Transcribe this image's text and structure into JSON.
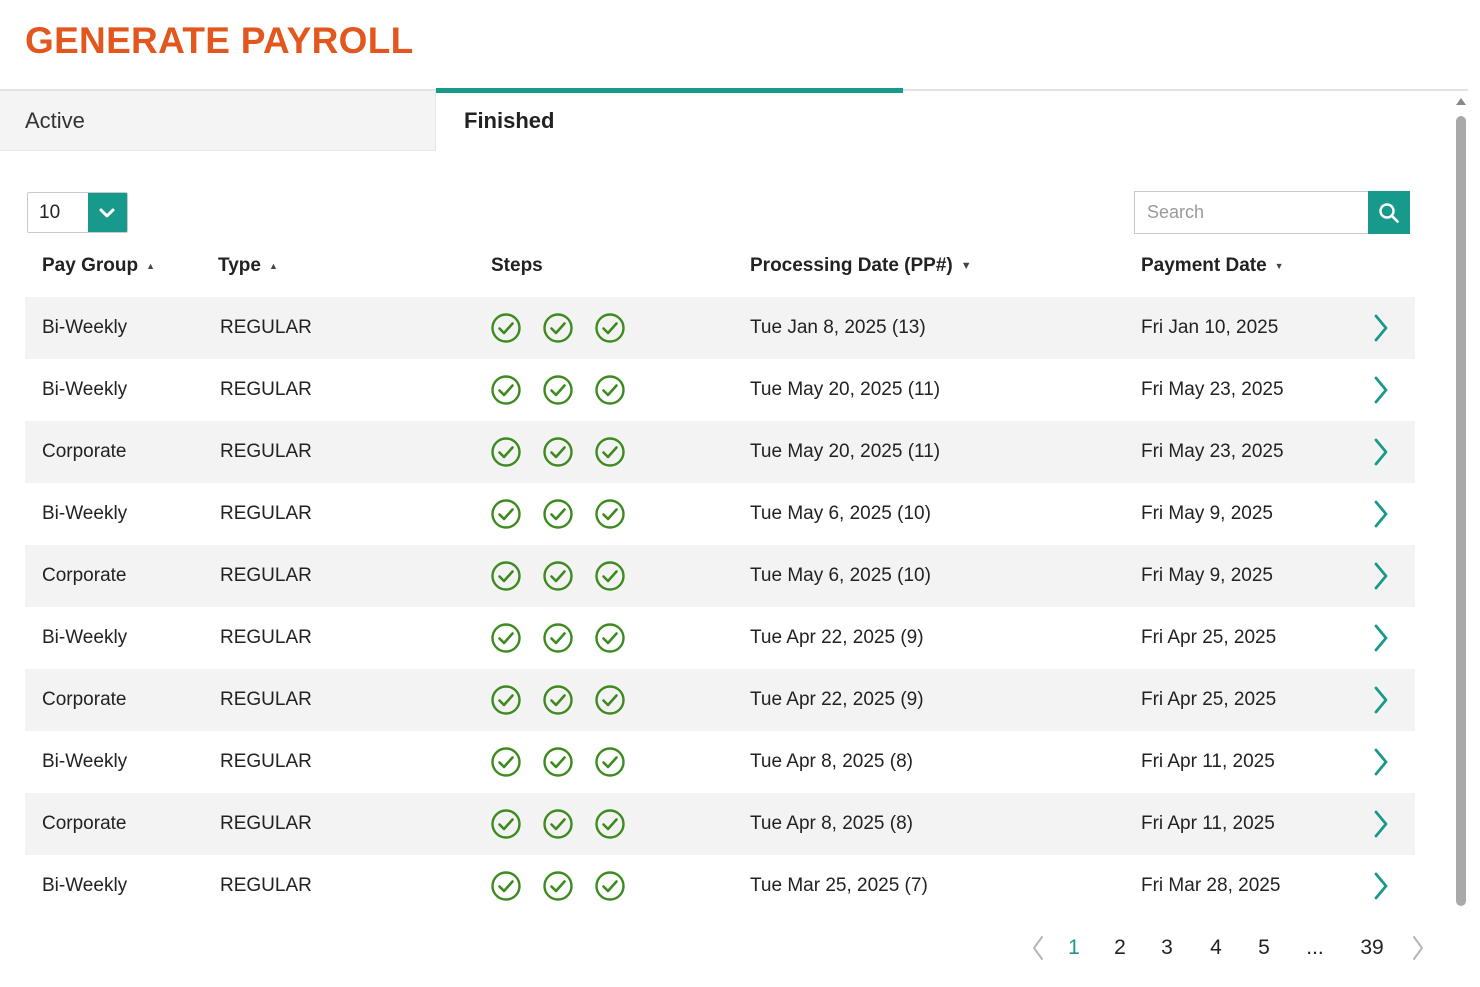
{
  "title": "GENERATE PAYROLL",
  "tabs": [
    {
      "label": "Active",
      "selected": false
    },
    {
      "label": "Finished",
      "selected": true
    }
  ],
  "accent_color": "#17998c",
  "title_color": "#e2571e",
  "step_check_color": "#3d8a1f",
  "page_size": {
    "value": "10",
    "icon": "chevron-down-icon"
  },
  "search": {
    "placeholder": "Search",
    "value": "",
    "icon": "search-icon"
  },
  "columns": [
    {
      "label": "Pay Group",
      "sort": "asc"
    },
    {
      "label": "Type",
      "sort": "asc"
    },
    {
      "label": "Steps",
      "sort": "none"
    },
    {
      "label": "Processing Date (PP#)",
      "sort": "desc"
    },
    {
      "label": "Payment Date",
      "sort": "desc"
    }
  ],
  "rows": [
    {
      "pay_group": "Bi-Weekly",
      "type": "REGULAR",
      "steps": [
        "done",
        "done",
        "done"
      ],
      "processing_date": "Tue Jan 8, 2025 (13)",
      "payment_date": "Fri Jan 10, 2025"
    },
    {
      "pay_group": "Bi-Weekly",
      "type": "REGULAR",
      "steps": [
        "done",
        "done",
        "done"
      ],
      "processing_date": "Tue May 20, 2025 (11)",
      "payment_date": "Fri May 23, 2025"
    },
    {
      "pay_group": "Corporate",
      "type": "REGULAR",
      "steps": [
        "done",
        "done",
        "done"
      ],
      "processing_date": "Tue May 20, 2025 (11)",
      "payment_date": "Fri May 23, 2025"
    },
    {
      "pay_group": "Bi-Weekly",
      "type": "REGULAR",
      "steps": [
        "done",
        "done",
        "done"
      ],
      "processing_date": "Tue May 6, 2025 (10)",
      "payment_date": "Fri May 9, 2025"
    },
    {
      "pay_group": "Corporate",
      "type": "REGULAR",
      "steps": [
        "done",
        "done",
        "done"
      ],
      "processing_date": "Tue May 6, 2025 (10)",
      "payment_date": "Fri May 9, 2025"
    },
    {
      "pay_group": "Bi-Weekly",
      "type": "REGULAR",
      "steps": [
        "done",
        "done",
        "done"
      ],
      "processing_date": "Tue Apr 22, 2025 (9)",
      "payment_date": "Fri Apr 25, 2025"
    },
    {
      "pay_group": "Corporate",
      "type": "REGULAR",
      "steps": [
        "done",
        "done",
        "done"
      ],
      "processing_date": "Tue Apr 22, 2025 (9)",
      "payment_date": "Fri Apr 25, 2025"
    },
    {
      "pay_group": "Bi-Weekly",
      "type": "REGULAR",
      "steps": [
        "done",
        "done",
        "done"
      ],
      "processing_date": "Tue Apr 8, 2025 (8)",
      "payment_date": "Fri Apr 11, 2025"
    },
    {
      "pay_group": "Corporate",
      "type": "REGULAR",
      "steps": [
        "done",
        "done",
        "done"
      ],
      "processing_date": "Tue Apr 8, 2025 (8)",
      "payment_date": "Fri Apr 11, 2025"
    },
    {
      "pay_group": "Bi-Weekly",
      "type": "REGULAR",
      "steps": [
        "done",
        "done",
        "done"
      ],
      "processing_date": "Tue Mar 25, 2025 (7)",
      "payment_date": "Fri Mar 28, 2025"
    }
  ],
  "pagination": {
    "prev_icon": "chevron-left-icon",
    "next_icon": "chevron-right-icon",
    "pages": [
      "1",
      "2",
      "3",
      "4",
      "5"
    ],
    "current": "1",
    "ellipsis": "...",
    "last": "39"
  }
}
